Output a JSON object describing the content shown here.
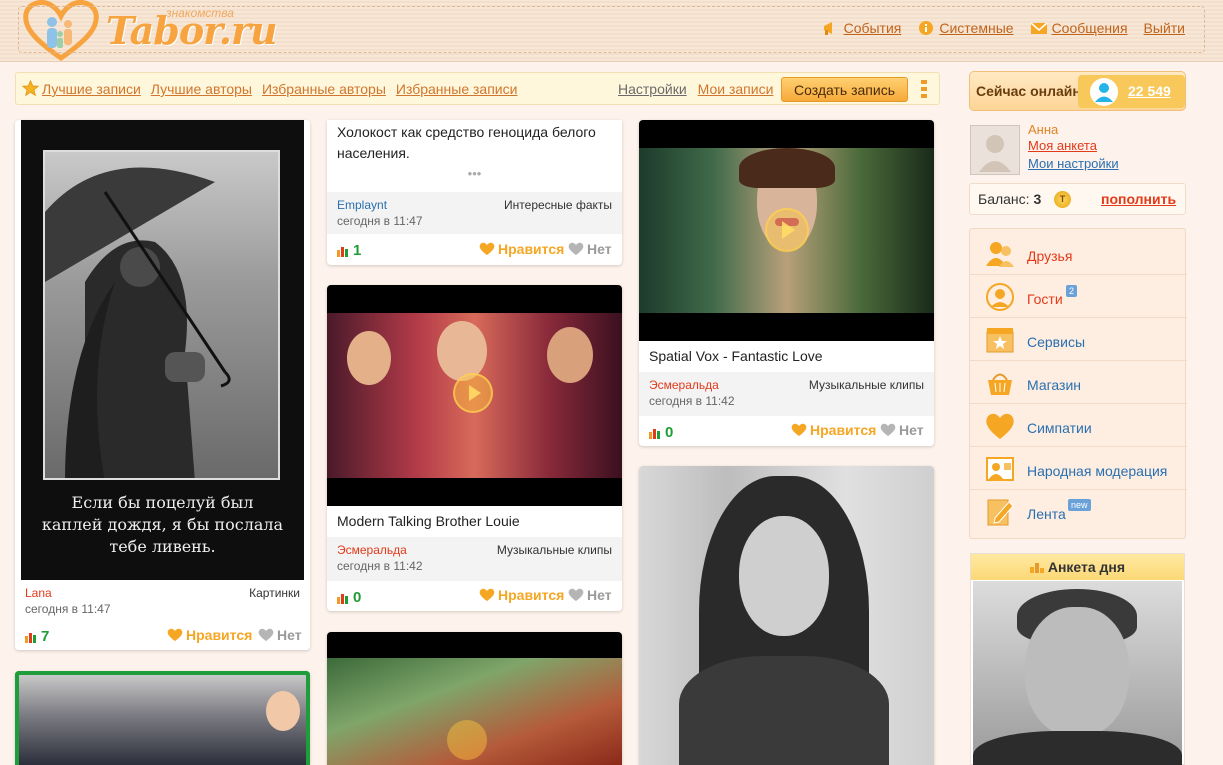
{
  "header": {
    "brand": "Tabor.ru",
    "tagline": "знакомства",
    "nav": [
      {
        "label": "События",
        "icon": "megaphone-icon"
      },
      {
        "label": "Системные",
        "icon": "info-icon"
      },
      {
        "label": "Сообщения",
        "icon": "envelope-icon"
      },
      {
        "label": "Выйти",
        "icon": ""
      }
    ]
  },
  "toolbar": {
    "links": [
      "Лучшие записи",
      "Лучшие авторы",
      "Избранные авторы",
      "Избранные записи"
    ],
    "settings": "Настройки",
    "my_posts": "Мои записи",
    "create": "Создать запись"
  },
  "feed": [
    {
      "id": "c1",
      "author": "Lana",
      "author_color": "#e33a1a",
      "category": "Картинки",
      "time": "сегодня в 11:47",
      "score": "7",
      "like": "Нравится",
      "no": "Нет",
      "poster_text": [
        "Если бы поцелуй был",
        "каплей дождя, я бы послала",
        "тебе ливень."
      ]
    },
    {
      "id": "c2",
      "text": "Холокост как средство геноцида белого населения.",
      "more": "•••",
      "author": "Emplaynt",
      "author_color": "#2a6fb0",
      "category": "Интересные факты",
      "time": "сегодня в 11:47",
      "score": "1",
      "like": "Нравится",
      "no": "Нет"
    },
    {
      "id": "c3",
      "caption": "Modern Talking Brother Louie",
      "author": "Эсмеральда",
      "author_color": "#e33a1a",
      "category": "Музыкальные клипы",
      "time": "сегодня в 11:42",
      "score": "0",
      "like": "Нравится",
      "no": "Нет"
    },
    {
      "id": "c4",
      "caption": "Spatial Vox - Fantastic Love",
      "author": "Эсмеральда",
      "author_color": "#e33a1a",
      "category": "Музыкальные клипы",
      "time": "сегодня в 11:42",
      "score": "0",
      "like": "Нравится",
      "no": "Нет"
    }
  ],
  "sidebar": {
    "online_label": "Сейчас онлайн:",
    "online_count": "22 549",
    "profile": {
      "name": "Анна",
      "link1": "Моя анкета",
      "link2": "Мои настройки"
    },
    "balance_label": "Баланс:",
    "balance_value": "3",
    "coin": "T",
    "topup": "пополнить",
    "menu": [
      {
        "label": "Друзья",
        "color": "#e33a1a",
        "icon": "friends-icon",
        "badge": ""
      },
      {
        "label": "Гости",
        "color": "#e33a1a",
        "icon": "guests-icon",
        "badge": "2"
      },
      {
        "label": "Сервисы",
        "color": "#2a6fb0",
        "icon": "services-icon",
        "badge": ""
      },
      {
        "label": "Магазин",
        "color": "#2a6fb0",
        "icon": "basket-icon",
        "badge": ""
      },
      {
        "label": "Симпатии",
        "color": "#2a6fb0",
        "icon": "heart-icon",
        "badge": ""
      },
      {
        "label": "Народная модерация",
        "color": "#2a6fb0",
        "icon": "moderation-icon",
        "badge": ""
      },
      {
        "label": "Лента",
        "color": "#2a6fb0",
        "icon": "feed-icon",
        "badge": "new"
      }
    ],
    "day_title": "Анкета дня"
  }
}
